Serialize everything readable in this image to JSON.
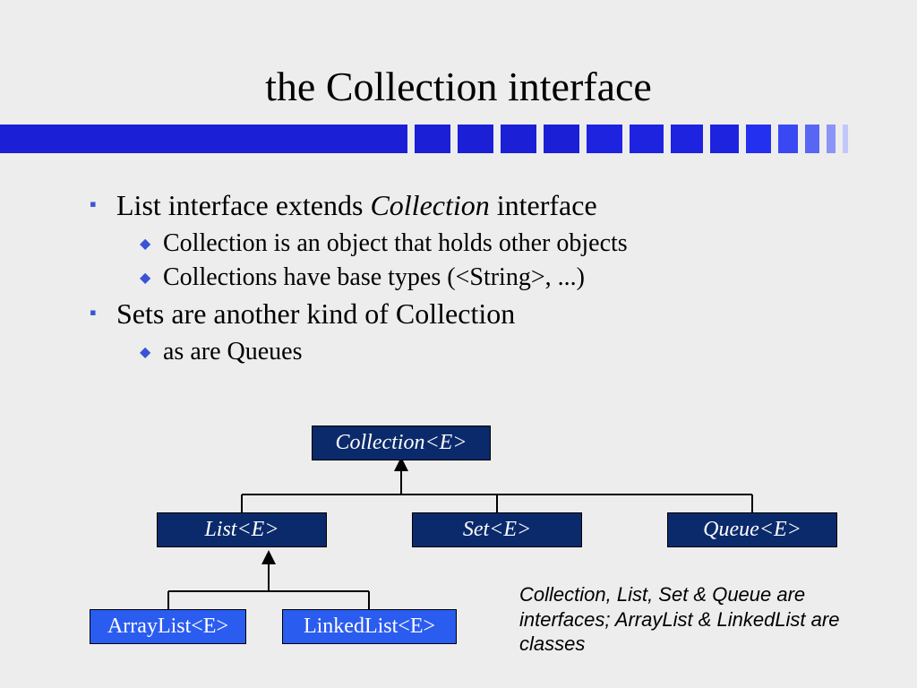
{
  "title": "the Collection interface",
  "bullets": {
    "b1_a": "List interface extends ",
    "b1_em": "Collection",
    "b1_b": " interface",
    "b1_1": "Collection is an object that holds other objects",
    "b1_2": "Collections have base types (<String>, ...)",
    "b2": "Sets are another kind of Collection",
    "b2_1": "as are Queues"
  },
  "nodes": {
    "collection": "Collection<E>",
    "list": "List<E>",
    "set": "Set<E>",
    "queue": "Queue<E>",
    "arraylist": "ArrayList<E>",
    "linkedlist": "LinkedList<E>"
  },
  "caption": "Collection, List, Set & Queue are interfaces; ArrayList & LinkedList are classes",
  "stripe_colors": [
    "#1b1fd5",
    "#1b1fd5",
    "#1b1fd5",
    "#1b1fd5",
    "#1b1fd5",
    "#1e23e0",
    "#1e23e0",
    "#1e23e0",
    "#1e23e0",
    "#2430f0",
    "#3948f2",
    "#5966f4",
    "#8a94f6",
    "#c2c8fa"
  ]
}
